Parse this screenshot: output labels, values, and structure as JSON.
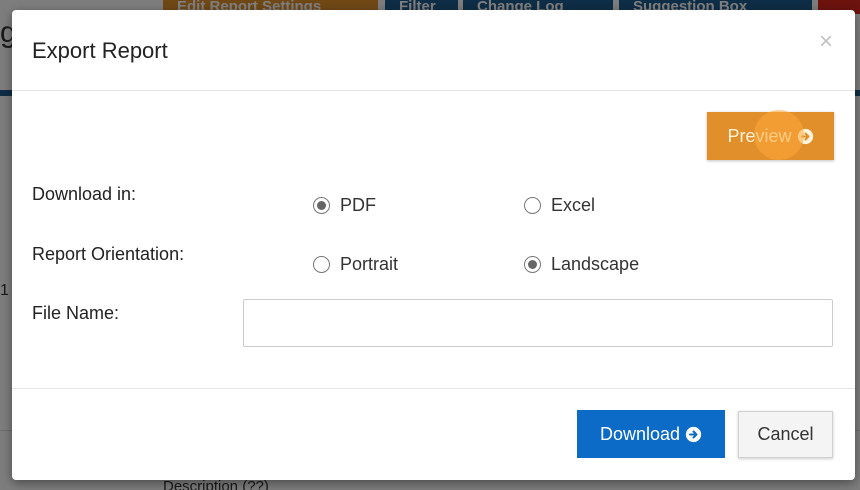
{
  "background": {
    "toolbar": {
      "edit_label": "Edit Report Settings",
      "filter_label": "Filter",
      "change_log_label": "Change Log",
      "suggestion_label": "Suggestion Box"
    },
    "heading_fragment": "g",
    "number_fragment": "1",
    "bottom_fragment": "Description (??)"
  },
  "modal": {
    "title": "Export Report",
    "close_symbol": "×",
    "preview_label": "Preview",
    "download_in": {
      "label": "Download in:",
      "options": [
        "PDF",
        "Excel"
      ],
      "selected": "PDF"
    },
    "orientation": {
      "label": "Report Orientation:",
      "options": [
        "Portrait",
        "Landscape"
      ],
      "selected": "Landscape"
    },
    "file_name": {
      "label": "File Name:",
      "value": ""
    },
    "download_label": "Download",
    "cancel_label": "Cancel"
  },
  "icons": {
    "preview": "arrow-circle-right-icon",
    "download": "arrow-circle-right-icon",
    "close": "close-icon"
  },
  "colors": {
    "preview_button": "#e08f2a",
    "download_button": "#0b6bc6",
    "toolbar_blue": "#1c5a8c"
  }
}
